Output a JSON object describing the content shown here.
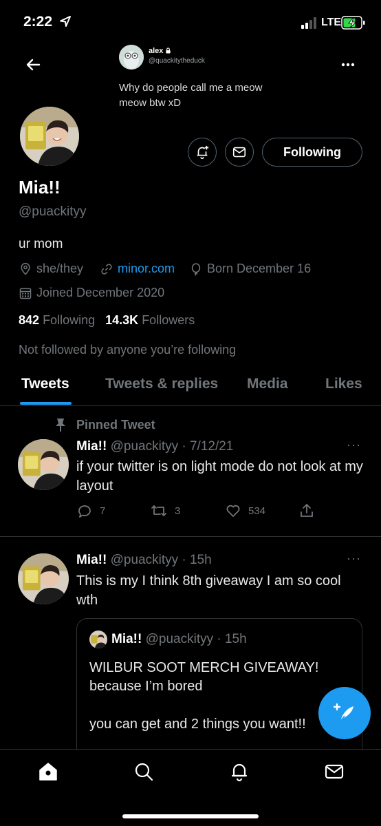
{
  "status_bar": {
    "time": "2:22",
    "network": "LTE"
  },
  "banner_quote": {
    "name": "alex",
    "handle": "@quackitytheduck",
    "text": "Why do people call me a meow meow btw xD"
  },
  "profile": {
    "display_name": "Mia!!",
    "handle": "@puackityy",
    "bio": "ur mom",
    "pronouns": "she/they",
    "link": "minor.com",
    "birthday": "Born December 16",
    "joined": "Joined December 2020",
    "following_count": "842",
    "following_label": "Following",
    "followers_count": "14.3K",
    "followers_label": "Followers",
    "not_followed_text": "Not followed by anyone you’re following",
    "following_button": "Following"
  },
  "tabs": [
    {
      "label": "Tweets",
      "active": true
    },
    {
      "label": "Tweets & replies",
      "active": false
    },
    {
      "label": "Media",
      "active": false
    },
    {
      "label": "Likes",
      "active": false
    }
  ],
  "pinned_tweet": {
    "pinned_label": "Pinned Tweet",
    "name": "Mia!!",
    "handle_date": "@puackityy · 7/12/21",
    "text": "if your twitter is on light mode do not look at my layout",
    "replies": "7",
    "retweets": "3",
    "likes": "534"
  },
  "tweet2": {
    "name": "Mia!!",
    "handle_date": "@puackityy · 15h",
    "text": "This is my I think 8th giveaway I am so cool wth",
    "quote": {
      "name": "Mia!!",
      "handle_date": "@puackityy · 15h",
      "line1": "WILBUR SOOT MERCH GIVEAWAY!",
      "line2": "because I’m bored",
      "line3": "you can get and 2 things you want!!"
    }
  },
  "colors": {
    "accent": "#1d9bf0",
    "background": "#000000",
    "muted": "#71767b",
    "border": "#2f3336"
  }
}
